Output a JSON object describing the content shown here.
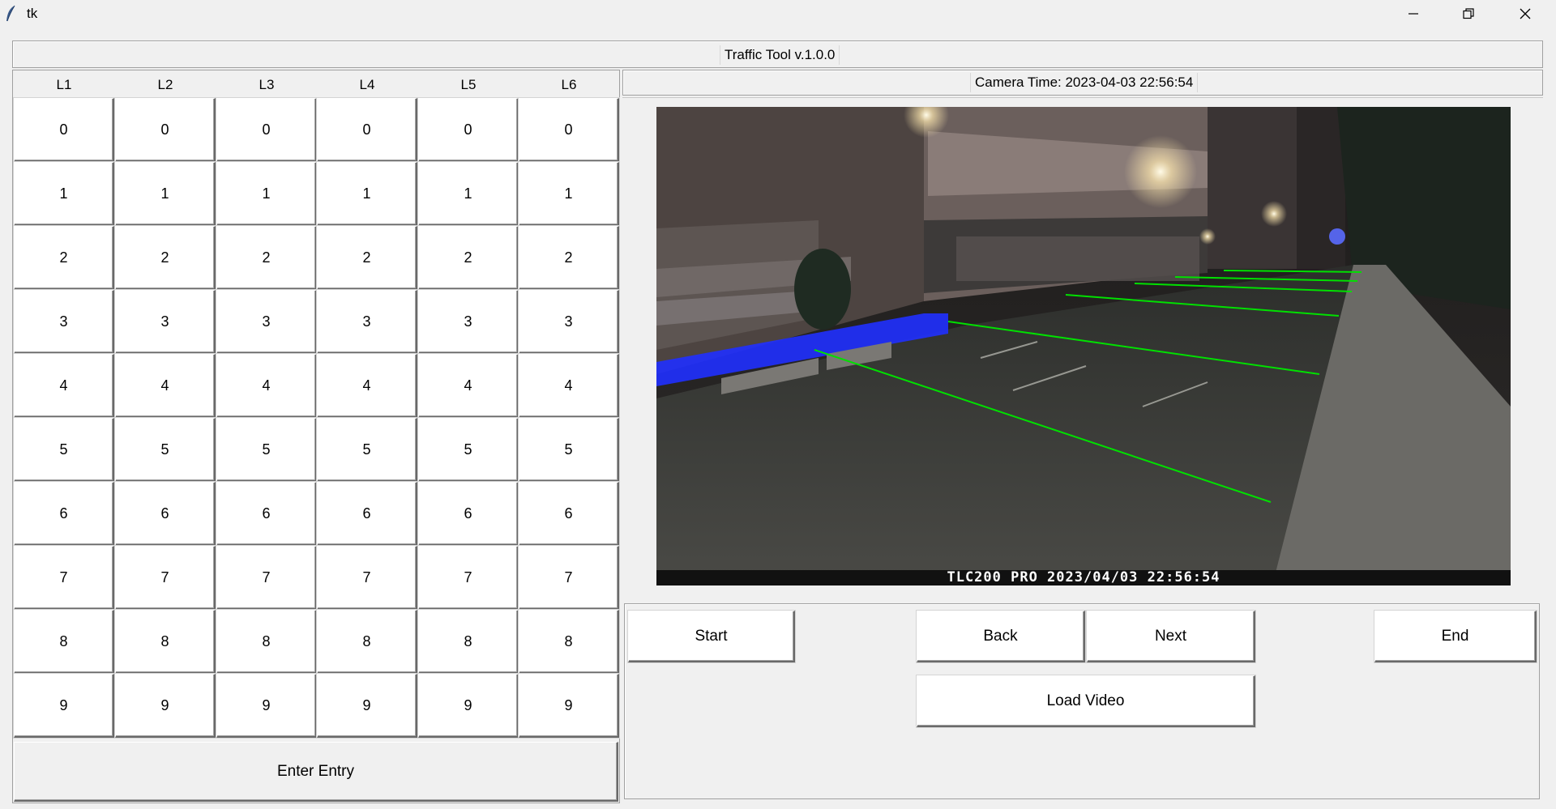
{
  "window": {
    "title": "tk"
  },
  "header": {
    "app_title": "Traffic Tool v.1.0.0"
  },
  "counter": {
    "columns": [
      "L1",
      "L2",
      "L3",
      "L4",
      "L5",
      "L6"
    ],
    "digits": [
      "0",
      "1",
      "2",
      "3",
      "4",
      "5",
      "6",
      "7",
      "8",
      "9"
    ],
    "enter_label": "Enter Entry"
  },
  "camera": {
    "time_label": "Camera Time: 2023-04-03 22:56:54",
    "overlay_text": "TLC200 PRO 2023/04/03 22:56:54"
  },
  "controls": {
    "start_label": "Start",
    "back_label": "Back",
    "next_label": "Next",
    "end_label": "End",
    "load_video_label": "Load Video"
  },
  "colors": {
    "detection_line": "#00e000",
    "barrier_highlight": "#2030ff",
    "window_bg": "#f0f0f0"
  },
  "icons": [
    "tk-feather-icon",
    "minimize-icon",
    "restore-icon",
    "close-icon"
  ]
}
